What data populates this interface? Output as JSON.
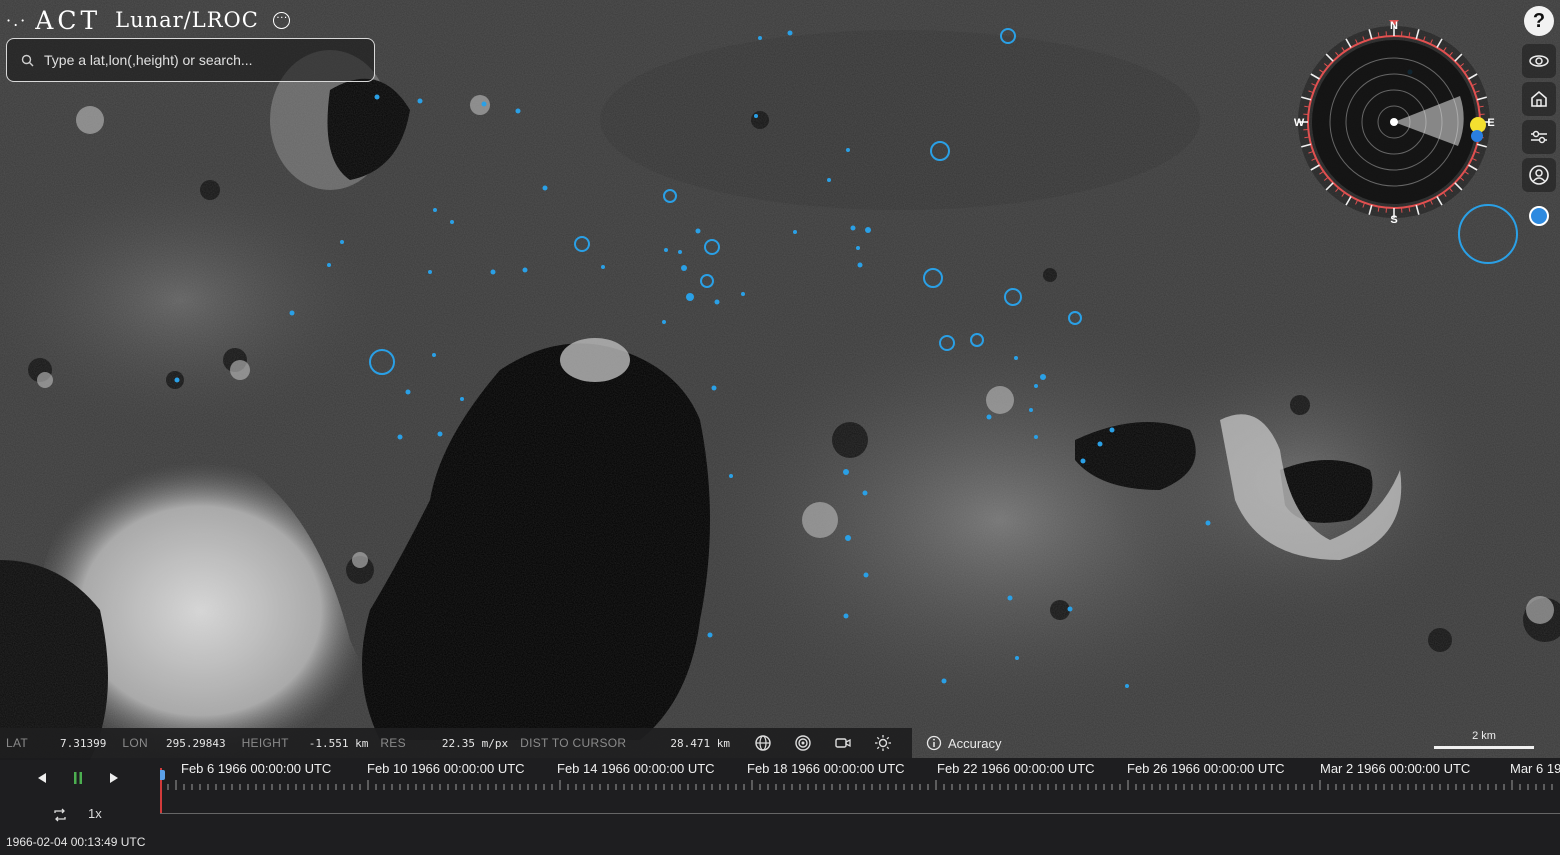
{
  "app": {
    "brand_dots": "·.·",
    "brand_name": "ACT",
    "mission": "Lunar/LROC"
  },
  "search": {
    "placeholder": "Type a lat,lon(,height) or search..."
  },
  "toolbar": {
    "help_label": "?",
    "icons": [
      "help-icon",
      "reset-view-icon",
      "home-icon",
      "settings-sliders-icon",
      "account-icon",
      "layer-toggle-icon"
    ]
  },
  "compass": {
    "north": "N",
    "south": "S",
    "east": "E",
    "west": "W"
  },
  "status": {
    "lat_label": "LAT",
    "lat_value": "7.31399",
    "lon_label": "LON",
    "lon_value": "295.29843",
    "height_label": "HEIGHT",
    "height_value": "-1.551 km",
    "res_label": "RES",
    "res_value": "22.35 m/px",
    "dist_label": "DIST TO CURSOR",
    "dist_value": "28.471 km",
    "accuracy_label": "Accuracy"
  },
  "scale": {
    "label": "2 km"
  },
  "playback": {
    "speed": "1x",
    "current_time": "1966-02-04 00:13:49 UTC"
  },
  "timeline": {
    "labels": [
      "Feb 6 1966 00:00:00 UTC",
      "Feb 10 1966 00:00:00 UTC",
      "Feb 14 1966 00:00:00 UTC",
      "Feb 18 1966 00:00:00 UTC",
      "Feb 22 1966 00:00:00 UTC",
      "Feb 26 1966 00:00:00 UTC",
      "Mar 2 1966 00:00:00 UTC",
      "Mar 6 19"
    ]
  },
  "colors": {
    "marker_blue": "#2aa0e6",
    "compass_red": "#e05050",
    "sun_yellow": "#f4e030"
  }
}
